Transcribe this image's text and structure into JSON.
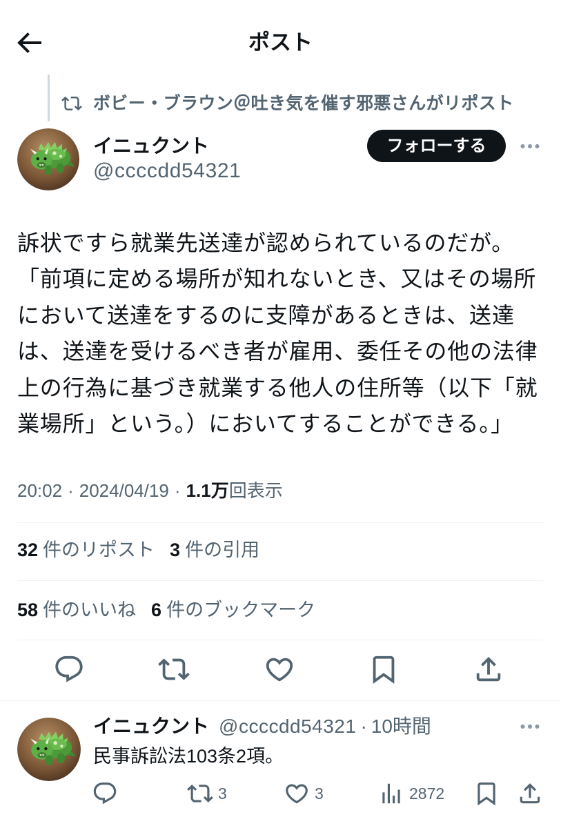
{
  "colors": {
    "text": "#0f1419",
    "secondary": "#536471",
    "divider": "#eff3f4",
    "rail": "#cfd9de",
    "button_bg": "#0f1419",
    "button_text": "#ffffff",
    "background": "#ffffff"
  },
  "header": {
    "back_icon": "back-arrow-icon",
    "title": "ポスト"
  },
  "repost_context": {
    "icon": "retweet-icon",
    "text": "ボビー・ブラウン＠吐き気を催す邪悪さんがリポスト"
  },
  "tweet": {
    "author": {
      "name": "イニュクント",
      "handle": "@ccccdd54321"
    },
    "follow_label": "フォローする",
    "more_icon": "more-icon",
    "text_lines": [
      "訴状ですら就業先送達が認められているのだが。",
      "「前項に定める場所が知れないとき、又はその場所",
      "において送達をするのに支障があるときは、送達",
      "は、送達を受けるべき者が雇用、委任その他の法律",
      "上の行為に基づき就業する他人の住所等（以下「就",
      "業場所」という。）においてすることができる。」"
    ],
    "time": "20:02",
    "separator": "·",
    "date": "2024/04/19",
    "views": {
      "count": "1.1万",
      "label": "回表示"
    },
    "stats": {
      "reposts": {
        "count": "32",
        "label": "件のリポスト"
      },
      "quotes": {
        "count": "3",
        "label": "件の引用"
      },
      "likes": {
        "count": "58",
        "label": "件のいいね"
      },
      "bookmarks": {
        "count": "6",
        "label": "件のブックマーク"
      }
    },
    "actions": [
      {
        "icon": "reply-icon"
      },
      {
        "icon": "retweet-icon"
      },
      {
        "icon": "like-icon"
      },
      {
        "icon": "bookmark-icon"
      },
      {
        "icon": "share-icon"
      }
    ]
  },
  "reply": {
    "author": {
      "name": "イニュクント",
      "handle": "@ccccdd54321"
    },
    "separator": "·",
    "time_ago": "10時間",
    "more_icon": "more-icon",
    "text": "民事訴訟法103条2項。",
    "actions": [
      {
        "icon": "reply-icon"
      },
      {
        "icon": "retweet-icon",
        "count": "3"
      },
      {
        "icon": "like-icon",
        "count": "3"
      },
      {
        "icon": "views-icon",
        "count": "2872"
      },
      {
        "icon": "bookmark-icon"
      },
      {
        "icon": "share-icon"
      }
    ]
  }
}
